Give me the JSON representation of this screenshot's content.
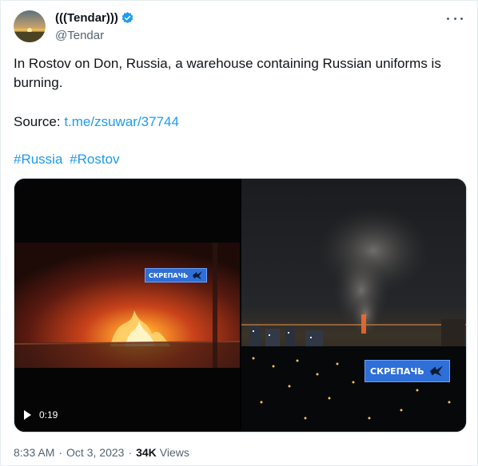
{
  "author": {
    "display_name": "(((Tendar)))",
    "handle": "@Tendar",
    "verified": true,
    "avatar_icon": "sunset-landscape-avatar"
  },
  "menu": {
    "icon": "more-horizontal-icon"
  },
  "tweet": {
    "text": "In Rostov on Don, Russia, a warehouse containing Russian uniforms is burning.",
    "source_label": "Source: ",
    "source_link": "t.me/zsuwar/37744",
    "hashtags": [
      "#Russia",
      "#Rostov"
    ]
  },
  "media": {
    "video": {
      "duration": "0:19",
      "watermark": "СКРЕПАЧЬ"
    },
    "photo": {
      "watermark": "СКРЕПАЧЬ"
    }
  },
  "meta": {
    "time": "8:33 AM",
    "separator": "·",
    "date": "Oct 3, 2023",
    "views_count": "34K",
    "views_label": "Views"
  },
  "colors": {
    "link": "#1d9bf0",
    "verified": "#1d9bf0",
    "text": "#0f1419",
    "secondary": "#536471",
    "watermark_bg": "#2e6fd8"
  }
}
